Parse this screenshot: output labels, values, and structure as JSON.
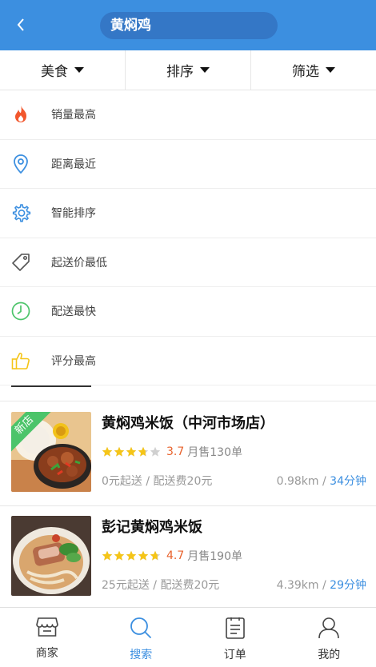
{
  "header": {
    "search_value": "黄焖鸡"
  },
  "filters": [
    {
      "label": "美食"
    },
    {
      "label": "排序"
    },
    {
      "label": "筛选"
    }
  ],
  "sort_options": [
    {
      "label": "销量最高",
      "icon": "fire-icon",
      "color": "#f2572d"
    },
    {
      "label": "距离最近",
      "icon": "location-pin-icon",
      "color": "#3c8fe0"
    },
    {
      "label": "智能排序",
      "icon": "gear-icon",
      "color": "#3c8fe0"
    },
    {
      "label": "起送价最低",
      "icon": "price-tag-icon",
      "color": "#555555"
    },
    {
      "label": "配送最快",
      "icon": "clock-icon",
      "color": "#4cc46a"
    },
    {
      "label": "评分最高",
      "icon": "thumbs-up-icon",
      "color": "#f5c518"
    }
  ],
  "shops": [
    {
      "name": "黄焖鸡米饭（中河市场店）",
      "badge": "新店",
      "rating": 3.7,
      "score": "3.7",
      "monthly_sales": "月售130单",
      "min_order": "0元起送",
      "delivery_fee": "配送费20元",
      "distance": "0.98km",
      "time": "34分钟"
    },
    {
      "name": "彭记黄焖鸡米饭",
      "badge": "",
      "rating": 4.7,
      "score": "4.7",
      "monthly_sales": "月售190单",
      "min_order": "25元起送",
      "delivery_fee": "配送费20元",
      "distance": "4.39km",
      "time": "29分钟"
    }
  ],
  "separator": " / ",
  "tabbar": [
    {
      "label": "商家",
      "icon": "store-icon",
      "active": false
    },
    {
      "label": "搜索",
      "icon": "search-icon",
      "active": true
    },
    {
      "label": "订单",
      "icon": "order-list-icon",
      "active": false
    },
    {
      "label": "我的",
      "icon": "user-icon",
      "active": false
    }
  ],
  "colors": {
    "primary": "#3c8fe0",
    "score": "#e8622c",
    "star": "#f5c518",
    "new_badge": "#4cc46a"
  }
}
